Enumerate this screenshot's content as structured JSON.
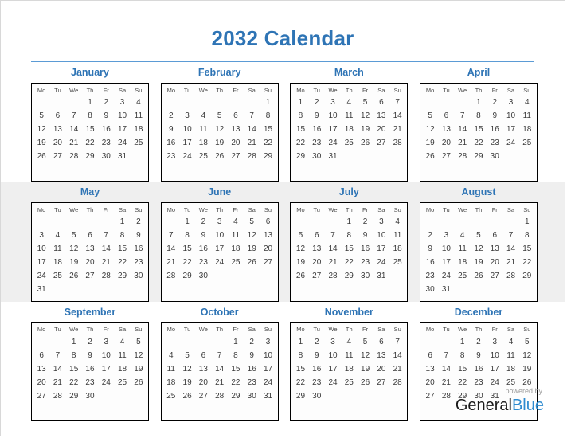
{
  "page": {
    "title": "2032 Calendar",
    "accent_color": "#2e74b5",
    "rule_color": "#5b9bd5",
    "band_color": "#efefef"
  },
  "weekdays": [
    "Mo",
    "Tu",
    "We",
    "Th",
    "Fr",
    "Sa",
    "Su"
  ],
  "footer": {
    "powered_by": "powered by",
    "brand_first": "General",
    "brand_second": "Blue",
    "brand_second_color": "#2e8bd0"
  },
  "months": [
    {
      "name": "January",
      "weeks": [
        [
          "",
          "",
          "",
          "1",
          "2",
          "3",
          "4"
        ],
        [
          "5",
          "6",
          "7",
          "8",
          "9",
          "10",
          "11"
        ],
        [
          "12",
          "13",
          "14",
          "15",
          "16",
          "17",
          "18"
        ],
        [
          "19",
          "20",
          "21",
          "22",
          "23",
          "24",
          "25"
        ],
        [
          "26",
          "27",
          "28",
          "29",
          "30",
          "31",
          ""
        ],
        [
          "",
          "",
          "",
          "",
          "",
          "",
          ""
        ]
      ]
    },
    {
      "name": "February",
      "weeks": [
        [
          "",
          "",
          "",
          "",
          "",
          "",
          "1"
        ],
        [
          "2",
          "3",
          "4",
          "5",
          "6",
          "7",
          "8"
        ],
        [
          "9",
          "10",
          "11",
          "12",
          "13",
          "14",
          "15"
        ],
        [
          "16",
          "17",
          "18",
          "19",
          "20",
          "21",
          "22"
        ],
        [
          "23",
          "24",
          "25",
          "26",
          "27",
          "28",
          "29"
        ],
        [
          "",
          "",
          "",
          "",
          "",
          "",
          ""
        ]
      ]
    },
    {
      "name": "March",
      "weeks": [
        [
          "1",
          "2",
          "3",
          "4",
          "5",
          "6",
          "7"
        ],
        [
          "8",
          "9",
          "10",
          "11",
          "12",
          "13",
          "14"
        ],
        [
          "15",
          "16",
          "17",
          "18",
          "19",
          "20",
          "21"
        ],
        [
          "22",
          "23",
          "24",
          "25",
          "26",
          "27",
          "28"
        ],
        [
          "29",
          "30",
          "31",
          "",
          "",
          "",
          ""
        ],
        [
          "",
          "",
          "",
          "",
          "",
          "",
          ""
        ]
      ]
    },
    {
      "name": "April",
      "weeks": [
        [
          "",
          "",
          "",
          "1",
          "2",
          "3",
          "4"
        ],
        [
          "5",
          "6",
          "7",
          "8",
          "9",
          "10",
          "11"
        ],
        [
          "12",
          "13",
          "14",
          "15",
          "16",
          "17",
          "18"
        ],
        [
          "19",
          "20",
          "21",
          "22",
          "23",
          "24",
          "25"
        ],
        [
          "26",
          "27",
          "28",
          "29",
          "30",
          "",
          ""
        ],
        [
          "",
          "",
          "",
          "",
          "",
          "",
          ""
        ]
      ]
    },
    {
      "name": "May",
      "weeks": [
        [
          "",
          "",
          "",
          "",
          "",
          "1",
          "2"
        ],
        [
          "3",
          "4",
          "5",
          "6",
          "7",
          "8",
          "9"
        ],
        [
          "10",
          "11",
          "12",
          "13",
          "14",
          "15",
          "16"
        ],
        [
          "17",
          "18",
          "19",
          "20",
          "21",
          "22",
          "23"
        ],
        [
          "24",
          "25",
          "26",
          "27",
          "28",
          "29",
          "30"
        ],
        [
          "31",
          "",
          "",
          "",
          "",
          "",
          ""
        ]
      ]
    },
    {
      "name": "June",
      "weeks": [
        [
          "",
          "1",
          "2",
          "3",
          "4",
          "5",
          "6"
        ],
        [
          "7",
          "8",
          "9",
          "10",
          "11",
          "12",
          "13"
        ],
        [
          "14",
          "15",
          "16",
          "17",
          "18",
          "19",
          "20"
        ],
        [
          "21",
          "22",
          "23",
          "24",
          "25",
          "26",
          "27"
        ],
        [
          "28",
          "29",
          "30",
          "",
          "",
          "",
          ""
        ],
        [
          "",
          "",
          "",
          "",
          "",
          "",
          ""
        ]
      ]
    },
    {
      "name": "July",
      "weeks": [
        [
          "",
          "",
          "",
          "1",
          "2",
          "3",
          "4"
        ],
        [
          "5",
          "6",
          "7",
          "8",
          "9",
          "10",
          "11"
        ],
        [
          "12",
          "13",
          "14",
          "15",
          "16",
          "17",
          "18"
        ],
        [
          "19",
          "20",
          "21",
          "22",
          "23",
          "24",
          "25"
        ],
        [
          "26",
          "27",
          "28",
          "29",
          "30",
          "31",
          ""
        ],
        [
          "",
          "",
          "",
          "",
          "",
          "",
          ""
        ]
      ]
    },
    {
      "name": "August",
      "weeks": [
        [
          "",
          "",
          "",
          "",
          "",
          "",
          "1"
        ],
        [
          "2",
          "3",
          "4",
          "5",
          "6",
          "7",
          "8"
        ],
        [
          "9",
          "10",
          "11",
          "12",
          "13",
          "14",
          "15"
        ],
        [
          "16",
          "17",
          "18",
          "19",
          "20",
          "21",
          "22"
        ],
        [
          "23",
          "24",
          "25",
          "26",
          "27",
          "28",
          "29"
        ],
        [
          "30",
          "31",
          "",
          "",
          "",
          "",
          ""
        ]
      ]
    },
    {
      "name": "September",
      "weeks": [
        [
          "",
          "",
          "1",
          "2",
          "3",
          "4",
          "5"
        ],
        [
          "6",
          "7",
          "8",
          "9",
          "10",
          "11",
          "12"
        ],
        [
          "13",
          "14",
          "15",
          "16",
          "17",
          "18",
          "19"
        ],
        [
          "20",
          "21",
          "22",
          "23",
          "24",
          "25",
          "26"
        ],
        [
          "27",
          "28",
          "29",
          "30",
          "",
          "",
          ""
        ],
        [
          "",
          "",
          "",
          "",
          "",
          "",
          ""
        ]
      ]
    },
    {
      "name": "October",
      "weeks": [
        [
          "",
          "",
          "",
          "",
          "1",
          "2",
          "3"
        ],
        [
          "4",
          "5",
          "6",
          "7",
          "8",
          "9",
          "10"
        ],
        [
          "11",
          "12",
          "13",
          "14",
          "15",
          "16",
          "17"
        ],
        [
          "18",
          "19",
          "20",
          "21",
          "22",
          "23",
          "24"
        ],
        [
          "25",
          "26",
          "27",
          "28",
          "29",
          "30",
          "31"
        ],
        [
          "",
          "",
          "",
          "",
          "",
          "",
          ""
        ]
      ]
    },
    {
      "name": "November",
      "weeks": [
        [
          "1",
          "2",
          "3",
          "4",
          "5",
          "6",
          "7"
        ],
        [
          "8",
          "9",
          "10",
          "11",
          "12",
          "13",
          "14"
        ],
        [
          "15",
          "16",
          "17",
          "18",
          "19",
          "20",
          "21"
        ],
        [
          "22",
          "23",
          "24",
          "25",
          "26",
          "27",
          "28"
        ],
        [
          "29",
          "30",
          "",
          "",
          "",
          "",
          ""
        ],
        [
          "",
          "",
          "",
          "",
          "",
          "",
          ""
        ]
      ]
    },
    {
      "name": "December",
      "weeks": [
        [
          "",
          "",
          "1",
          "2",
          "3",
          "4",
          "5"
        ],
        [
          "6",
          "7",
          "8",
          "9",
          "10",
          "11",
          "12"
        ],
        [
          "13",
          "14",
          "15",
          "16",
          "17",
          "18",
          "19"
        ],
        [
          "20",
          "21",
          "22",
          "23",
          "24",
          "25",
          "26"
        ],
        [
          "27",
          "28",
          "29",
          "30",
          "31",
          "",
          ""
        ],
        [
          "",
          "",
          "",
          "",
          "",
          "",
          ""
        ]
      ]
    }
  ]
}
